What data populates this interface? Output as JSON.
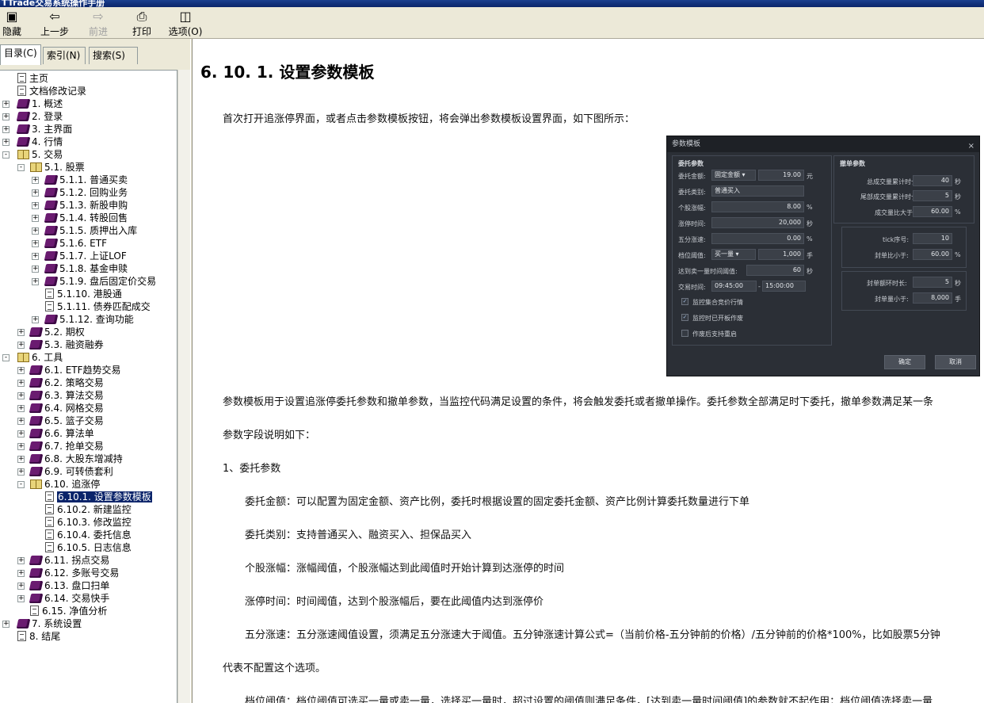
{
  "window": {
    "title": "TTrade交易系统操作手册"
  },
  "toolbar": {
    "hide_label": "隐藏",
    "back_label": "上一步",
    "forward_label": "前进",
    "print_label": "打印",
    "options_label": "选项(O)"
  },
  "tabs": {
    "contents": "目录(C)",
    "index": "索引(N)",
    "search": "搜索(S)"
  },
  "tree": [
    {
      "label": "主页",
      "icon": "page",
      "indent": 0,
      "expander": ""
    },
    {
      "label": "文档修改记录",
      "icon": "page",
      "indent": 0,
      "expander": ""
    },
    {
      "label": "1.  概述",
      "icon": "book-closed",
      "indent": 0,
      "expander": "+"
    },
    {
      "label": "2.  登录",
      "icon": "book-closed",
      "indent": 0,
      "expander": "+"
    },
    {
      "label": "3.  主界面",
      "icon": "book-closed",
      "indent": 0,
      "expander": "+"
    },
    {
      "label": "4.  行情",
      "icon": "book-closed",
      "indent": 0,
      "expander": "+"
    },
    {
      "label": "5.  交易",
      "icon": "book-open",
      "indent": 0,
      "expander": "-"
    },
    {
      "label": "5.1.  股票",
      "icon": "book-open",
      "indent": 1,
      "expander": "-"
    },
    {
      "label": "5.1.1.  普通买卖",
      "icon": "book-closed",
      "indent": 2,
      "expander": "+"
    },
    {
      "label": "5.1.2.  回购业务",
      "icon": "book-closed",
      "indent": 2,
      "expander": "+"
    },
    {
      "label": "5.1.3.  新股申购",
      "icon": "book-closed",
      "indent": 2,
      "expander": "+"
    },
    {
      "label": "5.1.4.  转股回售",
      "icon": "book-closed",
      "indent": 2,
      "expander": "+"
    },
    {
      "label": "5.1.5.  质押出入库",
      "icon": "book-closed",
      "indent": 2,
      "expander": "+"
    },
    {
      "label": "5.1.6.  ETF",
      "icon": "book-closed",
      "indent": 2,
      "expander": "+"
    },
    {
      "label": "5.1.7.  上证LOF",
      "icon": "book-closed",
      "indent": 2,
      "expander": "+"
    },
    {
      "label": "5.1.8.  基金申赎",
      "icon": "book-closed",
      "indent": 2,
      "expander": "+"
    },
    {
      "label": "5.1.9.  盘后固定价交易",
      "icon": "book-closed",
      "indent": 2,
      "expander": "+"
    },
    {
      "label": "5.1.10.  港股通",
      "icon": "page",
      "indent": 2,
      "expander": ""
    },
    {
      "label": "5.1.11.  债券匹配成交",
      "icon": "page",
      "indent": 2,
      "expander": ""
    },
    {
      "label": "5.1.12.  查询功能",
      "icon": "book-closed",
      "indent": 2,
      "expander": "+"
    },
    {
      "label": "5.2.  期权",
      "icon": "book-closed",
      "indent": 1,
      "expander": "+"
    },
    {
      "label": "5.3.  融资融券",
      "icon": "book-closed",
      "indent": 1,
      "expander": "+"
    },
    {
      "label": "6.  工具",
      "icon": "book-open",
      "indent": 0,
      "expander": "-"
    },
    {
      "label": "6.1.  ETF趋势交易",
      "icon": "book-closed",
      "indent": 1,
      "expander": "+"
    },
    {
      "label": "6.2.  策略交易",
      "icon": "book-closed",
      "indent": 1,
      "expander": "+"
    },
    {
      "label": "6.3.  算法交易",
      "icon": "book-closed",
      "indent": 1,
      "expander": "+"
    },
    {
      "label": "6.4.  网格交易",
      "icon": "book-closed",
      "indent": 1,
      "expander": "+"
    },
    {
      "label": "6.5.  篮子交易",
      "icon": "book-closed",
      "indent": 1,
      "expander": "+"
    },
    {
      "label": "6.6.  算法单",
      "icon": "book-closed",
      "indent": 1,
      "expander": "+"
    },
    {
      "label": "6.7.  抢单交易",
      "icon": "book-closed",
      "indent": 1,
      "expander": "+"
    },
    {
      "label": "6.8.  大股东增减持",
      "icon": "book-closed",
      "indent": 1,
      "expander": "+"
    },
    {
      "label": "6.9.  可转债套利",
      "icon": "book-closed",
      "indent": 1,
      "expander": "+"
    },
    {
      "label": "6.10.  追涨停",
      "icon": "book-open",
      "indent": 1,
      "expander": "-"
    },
    {
      "label": "6.10.1.  设置参数模板",
      "icon": "page",
      "indent": 2,
      "expander": "",
      "selected": true
    },
    {
      "label": "6.10.2.  新建监控",
      "icon": "page",
      "indent": 2,
      "expander": ""
    },
    {
      "label": "6.10.3.  修改监控",
      "icon": "page",
      "indent": 2,
      "expander": ""
    },
    {
      "label": "6.10.4.  委托信息",
      "icon": "page",
      "indent": 2,
      "expander": ""
    },
    {
      "label": "6.10.5.  日志信息",
      "icon": "page",
      "indent": 2,
      "expander": ""
    },
    {
      "label": "6.11.  拐点交易",
      "icon": "book-closed",
      "indent": 1,
      "expander": "+"
    },
    {
      "label": "6.12.  多账号交易",
      "icon": "book-closed",
      "indent": 1,
      "expander": "+"
    },
    {
      "label": "6.13.  盘口扫单",
      "icon": "book-closed",
      "indent": 1,
      "expander": "+"
    },
    {
      "label": "6.14.  交易快手",
      "icon": "book-closed",
      "indent": 1,
      "expander": "+"
    },
    {
      "label": "6.15.  净值分析",
      "icon": "page",
      "indent": 1,
      "expander": ""
    },
    {
      "label": "7.  系统设置",
      "icon": "book-closed",
      "indent": 0,
      "expander": "+"
    },
    {
      "label": "8.  结尾",
      "icon": "page",
      "indent": 0,
      "expander": ""
    }
  ],
  "content": {
    "heading": "6. 10. 1.  设置参数模板",
    "paragraphs": [
      "首次打开追涨停界面，或者点击参数模板按钮，将会弹出参数模板设置界面，如下图所示：",
      "参数模板用于设置追涨停委托参数和撤单参数，当监控代码满足设置的条件，将会触发委托或者撤单操作。委托参数全部满足时下委托，撤单参数满足某一条",
      "参数字段说明如下：",
      "1、委托参数",
      "委托金额：可以配置为固定金额、资产比例，委托时根据设置的固定委托金额、资产比例计算委托数量进行下单",
      "委托类别：支持普通买入、融资买入、担保品买入",
      "个股涨幅：涨幅阈值，个股涨幅达到此阈值时开始计算到达涨停的时间",
      "涨停时间：时间阈值，达到个股涨幅后，要在此阈值内达到涨停价",
      "五分涨速：五分涨速阈值设置，须满足五分涨速大于阈值。五分钟涨速计算公式=（当前价格-五分钟前的价格）/五分钟前的价格*100%，比如股票5分钟",
      "代表不配置这个选项。",
      "档位阈值：档位阈值可选买一量或卖一量，选择买一量时，超过设置的阈值则满足条件，[达到卖一量时间阈值]的参数就不起作用；档位阈值选择卖一量"
    ]
  },
  "dialog": {
    "title": "参数模板",
    "close_icon": "×",
    "entrust_group": "委托参数",
    "cancel_group": "撤单参数",
    "amount_label": "委托金额:",
    "amount_mode": "固定金额",
    "amount_value": "19.00",
    "amount_unit": "元",
    "type_label": "委托类别:",
    "type_value": "普通买入",
    "rise_label": "个股涨幅:",
    "rise_value": "8.00",
    "rise_unit": "%",
    "limit_time_label": "涨停时间:",
    "limit_time_value": "20,000",
    "limit_time_unit": "秒",
    "speed_label": "五分涨速:",
    "speed_value": "0.00",
    "speed_unit": "%",
    "level_label": "档位阈值:",
    "level_mode": "买一量",
    "level_value": "1,000",
    "level_unit": "手",
    "sell_time_label": "达到卖一量时间阈值:",
    "sell_time_value": "60",
    "sell_time_unit": "秒",
    "trade_time_label": "交易时间:",
    "trade_time_start": "09:45:00",
    "trade_time_sep": "-",
    "trade_time_end": "15:00:00",
    "chk_auction": "监控集合竞价行情",
    "chk_open": "监控时已开板作废",
    "chk_restart": "作废后支持重启",
    "total_vol_time_label": "总成交量累计时长:",
    "total_vol_time_value": "40",
    "total_vol_time_unit": "秒",
    "tail_vol_time_label": "尾部成交量累计时长:",
    "tail_vol_time_value": "5",
    "tail_vol_time_unit": "秒",
    "vol_ratio_label": "成交量比大于:",
    "vol_ratio_value": "60.00",
    "vol_ratio_unit": "%",
    "tick_label": "tick序号:",
    "tick_value": "10",
    "seal_ratio_label": "封单比小于:",
    "seal_ratio_value": "60.00",
    "seal_ratio_unit": "%",
    "seal_time_label": "封单额环时长:",
    "seal_time_value": "5",
    "seal_time_unit": "秒",
    "seal_amount_label": "封单量小于:",
    "seal_amount_value": "8,000",
    "seal_amount_unit": "手",
    "ok_label": "确定",
    "cancel_label": "取消"
  }
}
